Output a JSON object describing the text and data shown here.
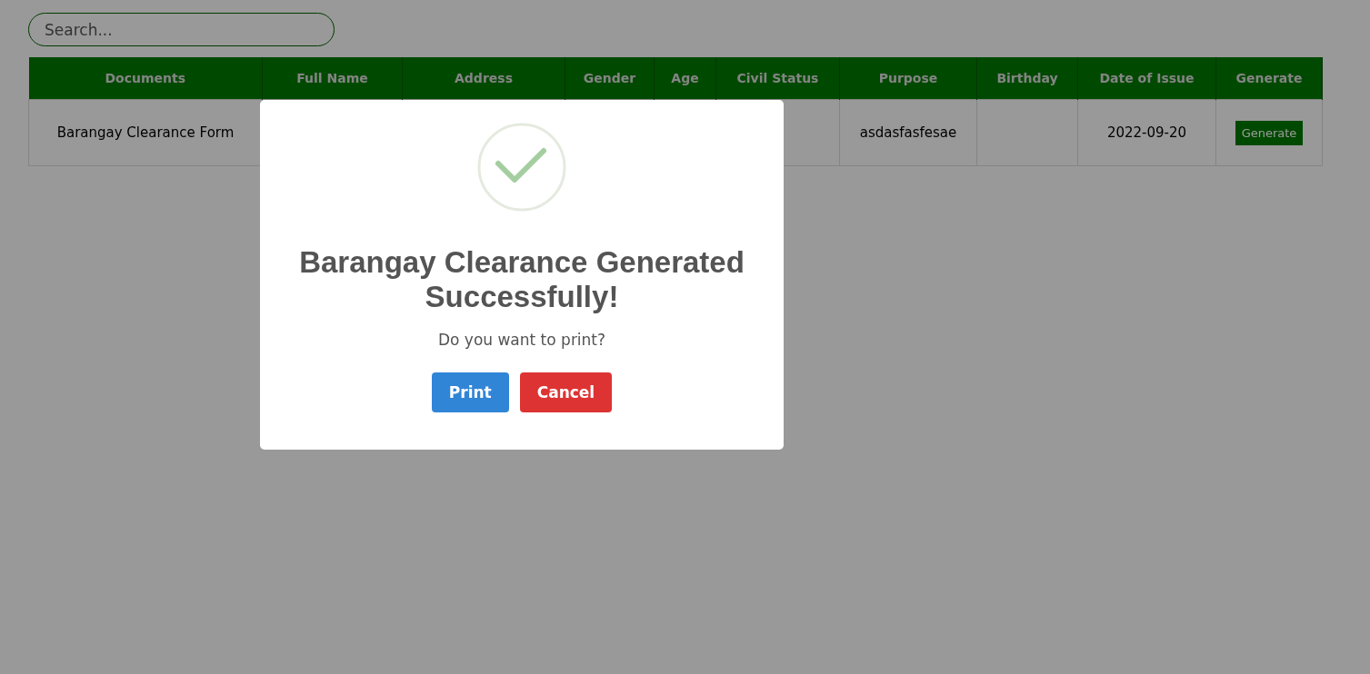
{
  "search": {
    "placeholder": "Search..."
  },
  "table": {
    "columns": [
      "Documents",
      "Full Name",
      "Address",
      "Gender",
      "Age",
      "Civil Status",
      "Purpose",
      "Birthday",
      "Date of Issue",
      "Generate"
    ],
    "rows": [
      {
        "document": "Barangay Clearance Form",
        "purpose": "asdasfasfesae",
        "date_of_issue": "2022-09-20",
        "action": "Generate"
      }
    ]
  },
  "dialog": {
    "kind": "success",
    "title": "Barangay Clearance Generated Successfully!",
    "message": "Do you want to print?",
    "buttons": [
      {
        "label": "Print",
        "kind": "confirm"
      },
      {
        "label": "Cancel",
        "kind": "cancel"
      }
    ]
  }
}
